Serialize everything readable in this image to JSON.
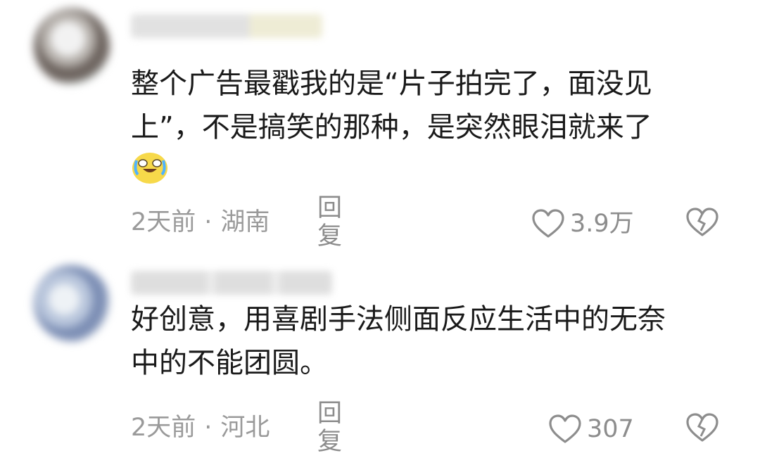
{
  "comments": [
    {
      "text_lines": [
        "整个广告最戳我的是“片子拍完了，面没见",
        "上”，不是搞笑的那种，是突然眼泪就来了"
      ],
      "time": "2天前",
      "separator": "·",
      "location": "湖南",
      "reply_label": "回复",
      "likes": "3.9万",
      "emoji": "crying-laughing-emoji"
    },
    {
      "text_lines": [
        "好创意，用喜剧手法侧面反应生活中的无奈",
        "中的不能团圆。"
      ],
      "time": "2天前",
      "separator": "·",
      "location": "河北",
      "reply_label": "回复",
      "likes": "307"
    }
  ],
  "colors": {
    "text": "#1a1a1a",
    "meta": "#9a9a9a",
    "icon": "#8d8d8d",
    "emoji_face": "#f7d94a"
  }
}
